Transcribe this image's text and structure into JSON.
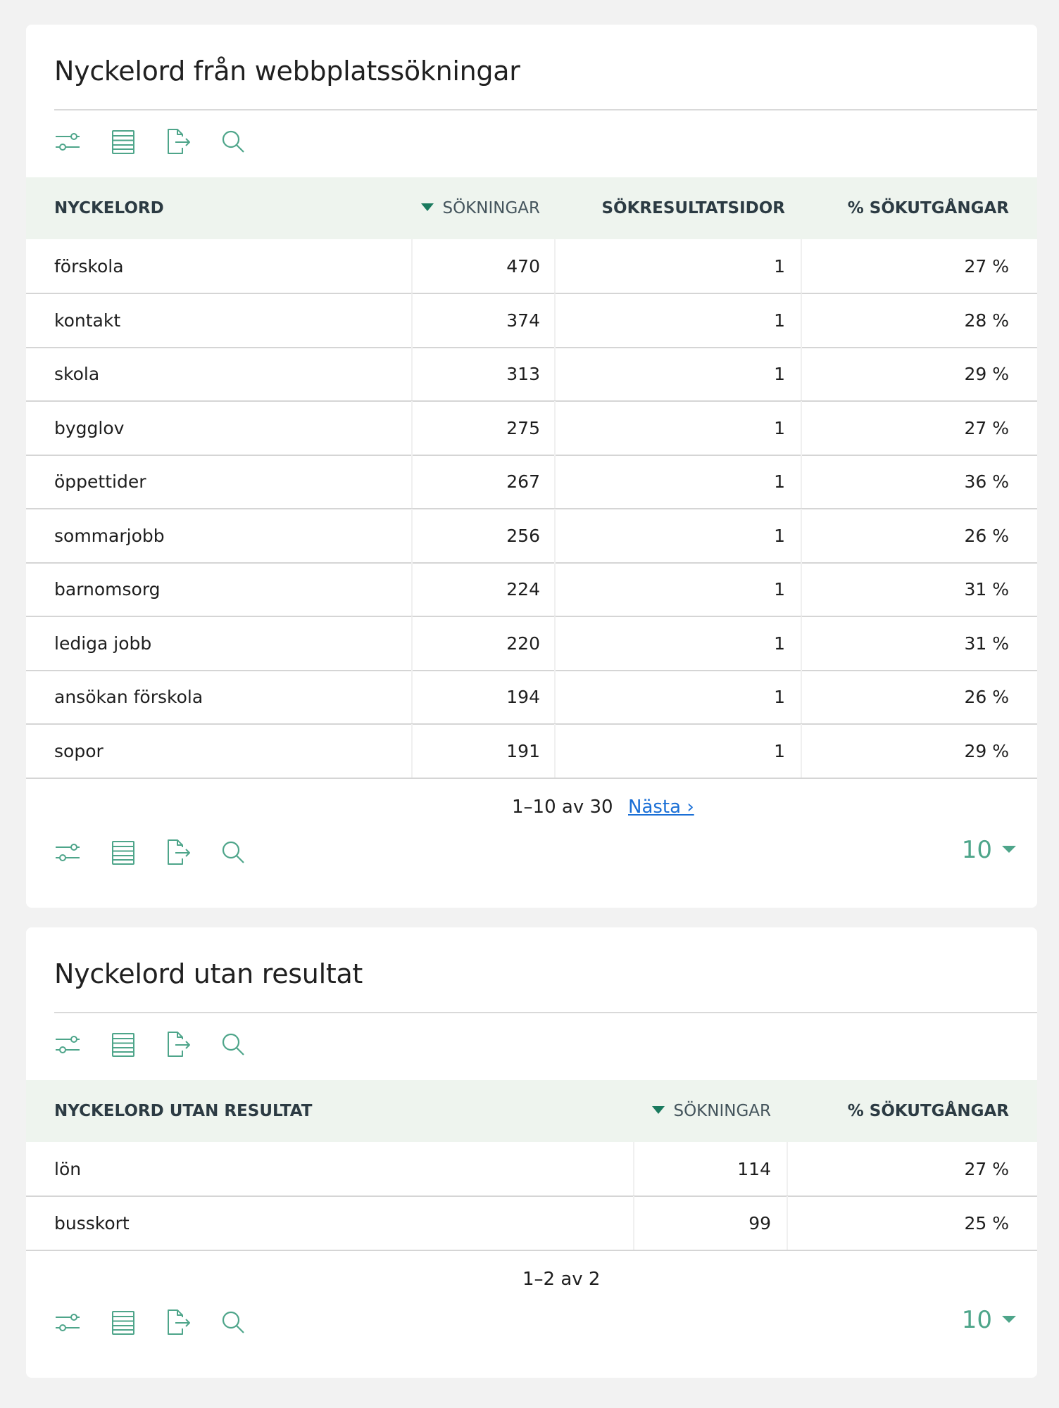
{
  "panels": [
    {
      "title": "Nyckelord från webbplatssökningar",
      "headers": [
        "NYCKELORD",
        "SÖKNINGAR",
        "SÖKRESULTATSIDOR",
        "% SÖKUTGÅNGAR"
      ],
      "sorted_column": "SÖKNINGAR",
      "rows": [
        [
          "förskola",
          "470",
          "1",
          "27 %"
        ],
        [
          "kontakt",
          "374",
          "1",
          "28 %"
        ],
        [
          "skola",
          "313",
          "1",
          "29 %"
        ],
        [
          "bygglov",
          "275",
          "1",
          "27 %"
        ],
        [
          "öppettider",
          "267",
          "1",
          "36 %"
        ],
        [
          "sommarjobb",
          "256",
          "1",
          "26 %"
        ],
        [
          "barnomsorg",
          "224",
          "1",
          "31 %"
        ],
        [
          "lediga jobb",
          "220",
          "1",
          "31 %"
        ],
        [
          "ansökan förskola",
          "194",
          "1",
          "26 %"
        ],
        [
          "sopor",
          "191",
          "1",
          "29 %"
        ]
      ],
      "pagination": "1–10 av 30",
      "next_label": "Nästa ›",
      "page_size": "10"
    },
    {
      "title": "Nyckelord utan resultat",
      "headers": [
        "NYCKELORD UTAN RESULTAT",
        "SÖKNINGAR",
        "% SÖKUTGÅNGAR"
      ],
      "sorted_column": "SÖKNINGAR",
      "rows": [
        [
          "lön",
          "114",
          "27 %"
        ],
        [
          "busskort",
          "99",
          "25 %"
        ]
      ],
      "pagination": "1–2 av 2",
      "page_size": "10"
    }
  ],
  "toolbar_icons": [
    "filter-sliders-icon",
    "table-view-icon",
    "export-icon",
    "search-icon"
  ],
  "colors": {
    "accent": "#4ea58a",
    "sort_arrow": "#1a7a5e",
    "header_bg": "#eef4ee",
    "link": "#1a6fd6",
    "page_bg": "#f2f2f2"
  }
}
